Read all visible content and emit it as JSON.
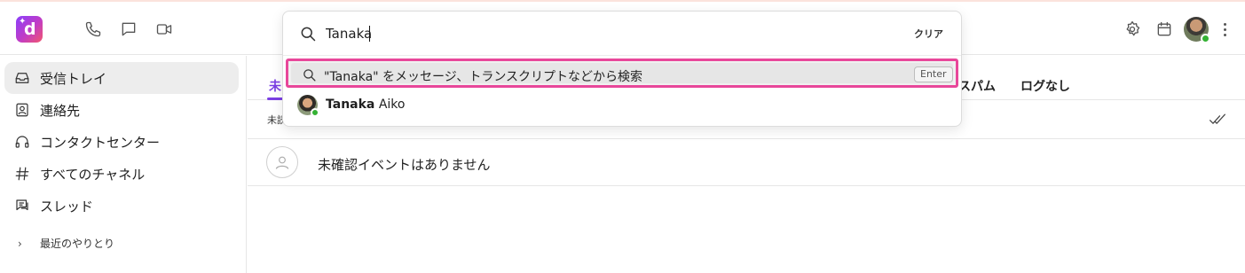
{
  "header": {
    "logo_letter": "d",
    "icons": [
      "phone-icon",
      "chat-icon",
      "video-icon",
      "settings-icon",
      "calendar-icon",
      "more-icon"
    ]
  },
  "search": {
    "value": "Tanaka",
    "clear_label": "クリア",
    "suggestion_text": "\"Tanaka\" をメッセージ、トランスクリプトなどから検索",
    "enter_label": "Enter",
    "result_first": "Tanaka",
    "result_last": "Aiko"
  },
  "sidebar": {
    "items": [
      {
        "label": "受信トレイ",
        "icon": "inbox-icon"
      },
      {
        "label": "連絡先",
        "icon": "contacts-icon"
      },
      {
        "label": "コンタクトセンター",
        "icon": "headset-icon"
      },
      {
        "label": "すべてのチャネル",
        "icon": "hash-icon"
      },
      {
        "label": "スレッド",
        "icon": "threads-icon"
      }
    ],
    "recent_label": "最近のやりとり"
  },
  "main": {
    "tab_first_partial": "未",
    "tabs_right": [
      "スパム",
      "ログなし"
    ],
    "subbar_partial": "未読",
    "empty_text": "未確認イベントはありません"
  },
  "colors": {
    "accent": "#7b3fe4",
    "highlight": "#e8479a",
    "presence": "#34b233"
  }
}
